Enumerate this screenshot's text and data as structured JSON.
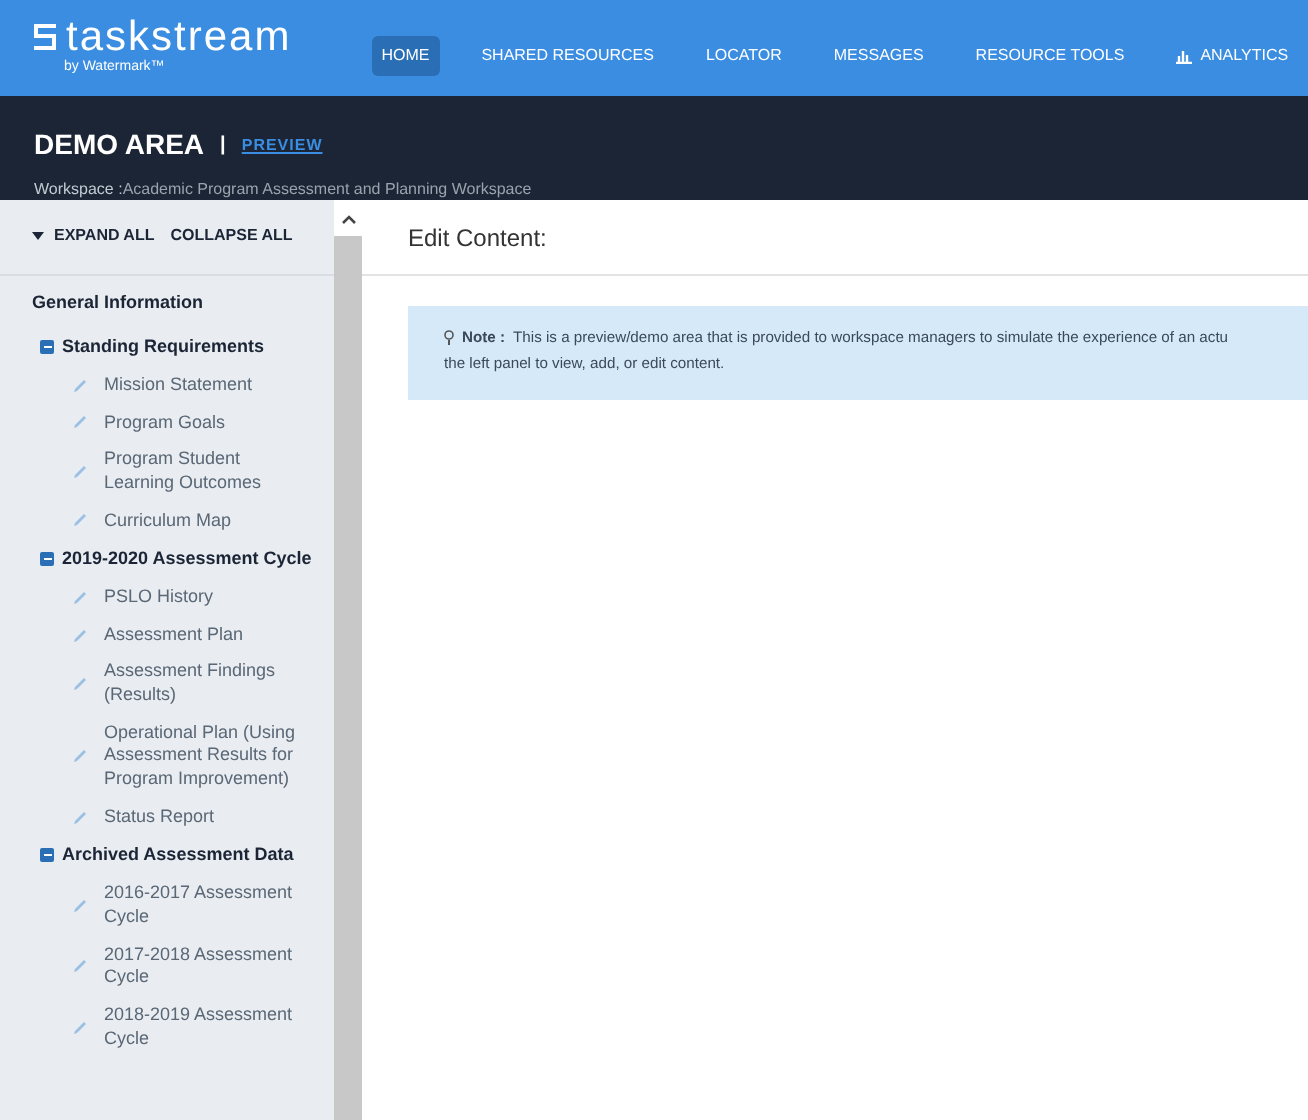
{
  "brand": {
    "name": "taskstream",
    "tagline": "by Watermark™"
  },
  "nav": [
    {
      "label": "HOME",
      "selected": true,
      "kind": "plain"
    },
    {
      "label": "SHARED RESOURCES",
      "selected": false,
      "kind": "plain"
    },
    {
      "label": "LOCATOR",
      "selected": false,
      "kind": "plain"
    },
    {
      "label": "MESSAGES",
      "selected": false,
      "kind": "plain"
    },
    {
      "label": "RESOURCE TOOLS",
      "selected": false,
      "kind": "plain"
    },
    {
      "label": "ANALYTICS",
      "selected": false,
      "kind": "chart"
    }
  ],
  "area": {
    "title": "DEMO AREA",
    "separator": "|",
    "mode": "PREVIEW",
    "workspace_label": "Workspace :",
    "workspace": "Academic Program Assessment and Planning Workspace"
  },
  "sidebar": {
    "expand_all": "EXPAND ALL",
    "collapse_all": "COLLAPSE ALL",
    "items": [
      {
        "label": "General Information",
        "kind": "plain"
      },
      {
        "label": "Standing Requirements",
        "kind": "section",
        "expanded": true,
        "children": [
          {
            "label": "Mission Statement"
          },
          {
            "label": "Program Goals"
          },
          {
            "label": "Program Student Learning Outcomes"
          },
          {
            "label": "Curriculum Map"
          }
        ]
      },
      {
        "label": "2019-2020 Assessment Cycle",
        "kind": "section",
        "expanded": true,
        "children": [
          {
            "label": "PSLO History"
          },
          {
            "label": "Assessment Plan"
          },
          {
            "label": "Assessment Findings (Results)"
          },
          {
            "label": "Operational Plan (Using Assessment Results for Program Improvement)"
          },
          {
            "label": "Status Report"
          }
        ]
      },
      {
        "label": "Archived Assessment Data",
        "kind": "section",
        "expanded": true,
        "children": [
          {
            "label": "2016-2017 Assessment Cycle"
          },
          {
            "label": "2017-2018 Assessment Cycle"
          },
          {
            "label": "2018-2019 Assessment Cycle"
          }
        ]
      }
    ]
  },
  "content": {
    "title": "Edit Content:",
    "note": {
      "label": "Note :",
      "line_1": "This is a preview/demo area that is provided to workspace managers to simulate the experience of an actu",
      "line_2": "the left panel to view, add, or edit content."
    }
  }
}
